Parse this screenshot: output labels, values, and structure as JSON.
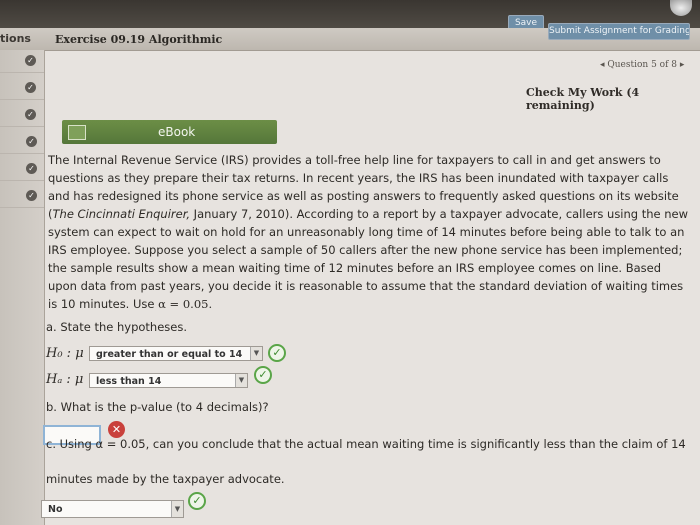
{
  "toolbar": {
    "save_label": "Save",
    "submit_label": "Submit Assignment for Grading"
  },
  "header": {
    "tab_label": "tions",
    "exercise_title": "Exercise 09.19 Algorithmic"
  },
  "navigation": {
    "pager": "◂ Question 5 of 8 ▸",
    "check_work": "Check My Work (4 remaining)"
  },
  "ebook": {
    "label": "eBook"
  },
  "passage": {
    "text1": "The Internal Revenue Service (IRS) provides a toll-free help line for taxpayers to call in and get answers to questions as they prepare their tax returns. In recent years, the IRS has been inundated with taxpayer calls and has redesigned its phone service as well as posting answers to frequently asked questions on its website (",
    "source": "The Cincinnati Enquirer,",
    "text2": " January 7, 2010). According to a report by a taxpayer advocate, callers using the new system can expect to wait on hold for an unreasonably long time of 14 minutes before being able to talk to an IRS employee. Suppose you select a sample of 50 callers after the new phone service has been implemented; the sample results show a mean waiting time of 12 minutes before an IRS employee comes on line. Based upon data from past years, you decide it is reasonable to assume that the standard deviation of waiting times is 10 minutes. Use ",
    "alpha_expr": "α = 0.05."
  },
  "part_a": {
    "label": "a. State the hypotheses.",
    "h0_symbol": "H₀ : μ",
    "h0_value": "greater than or equal to 14",
    "ha_symbol": "Hₐ : μ",
    "ha_value": "less than 14"
  },
  "part_b": {
    "label": "b. What is the p-value (to 4 decimals)?",
    "answer": ""
  },
  "part_c": {
    "line1": "c. Using α = 0.05, can you conclude that the actual mean waiting time is significantly less than the claim of 14",
    "line2": "minutes made by the taxpayer advocate.",
    "answer": "No"
  },
  "icons": {
    "correct": "check-circle-icon",
    "incorrect": "x-circle-icon",
    "sidebar_status": "check-circle-icon"
  },
  "colors": {
    "ebook_green": "#5f8240",
    "correct_green": "#5aa548",
    "incorrect_red": "#c9413c",
    "button_blue": "#6f8fa8"
  }
}
